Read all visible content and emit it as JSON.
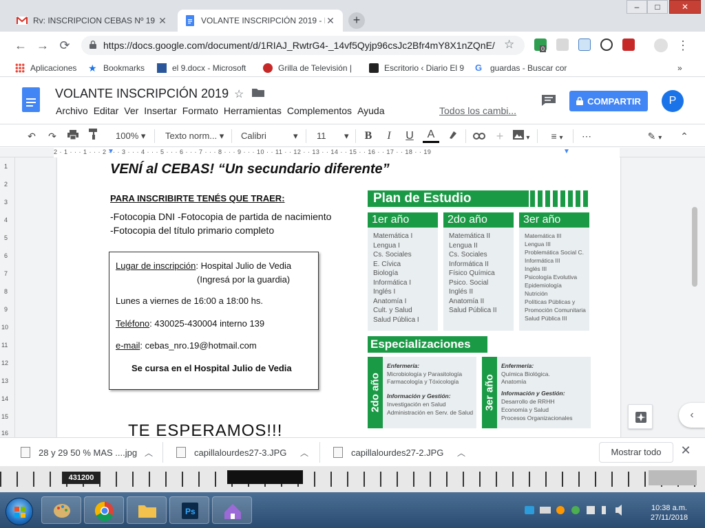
{
  "browser": {
    "tabs": [
      {
        "title": "Rv: INSCRIPCION CEBAS Nº 19 -",
        "icon": "gmail-icon"
      },
      {
        "title": "VOLANTE INSCRIPCIÓN 2019 - D",
        "icon": "docs-icon"
      }
    ],
    "url": "https://docs.google.com/document/d/1RIAJ_RwtrG4-_14vf5Qyjp96csJc2Bfr4mY8X1nZQnE/...",
    "extension_badge": "0",
    "bookmarks": [
      {
        "label": "Aplicaciones"
      },
      {
        "label": "Bookmarks"
      },
      {
        "label": "el 9.docx - Microsoft"
      },
      {
        "label": "Grilla de Televisión |"
      },
      {
        "label": "Escritorio ‹ Diario El 9"
      },
      {
        "label": "guardas - Buscar cor"
      }
    ],
    "bookmarks_more": "»"
  },
  "docs": {
    "title": "VOLANTE INSCRIPCIÓN 2019",
    "menu": [
      "Archivo",
      "Editar",
      "Ver",
      "Insertar",
      "Formato",
      "Herramientas",
      "Complementos",
      "Ayuda"
    ],
    "last_edit": "Todos los cambi...",
    "share_label": "COMPARTIR",
    "avatar_letter": "P",
    "toolbar": {
      "zoom": "100%",
      "style": "Texto norm...",
      "font": "Calibri",
      "size": "11"
    },
    "ruler_ticks": "2 · 1 · · · 1 · · · 2 · · · 3 · · · 4 · · · 5 · · · 6 · · · 7 · · · 8 · · · 9 · · · 10 · · 11 · · 12 · · 13 · · 14 · · 15 · · 16 · · 17 · · 18 · · 19",
    "vruler": [
      "1",
      "2",
      "3",
      "4",
      "5",
      "6",
      "7",
      "8",
      "9",
      "10",
      "11",
      "12",
      "13",
      "14",
      "15",
      "16"
    ]
  },
  "document": {
    "headline": "VENÍ al CEBAS! “Un secundario diferente”",
    "requirements_title": "PARA INSCRIBIRTE TENÉS QUE TRAER",
    "requirements_colon": ":",
    "requirements": [
      "-Fotocopia DNI   -Fotocopia de partida de nacimiento",
      "-Fotocopia del título primario completo"
    ],
    "info": {
      "place_label": "Lugar de inscripción",
      "place_value": ": Hospital Julio de Vedia",
      "place_note": "(Ingresá por la guardia)",
      "schedule": "Lunes a viernes de 16:00 a 18:00 hs.",
      "phone_label": "Teléfono",
      "phone_value": ": 430025-430004 interno 139",
      "email_label": "e-mail",
      "email_value": ": cebas_nro.19@hotmail.com",
      "footer": "Se cursa en el Hospital Julio de Vedia"
    },
    "closing": "TE   ESPERAMOS!!!"
  },
  "study_plan": {
    "title": "Plan de Estudio",
    "years": [
      {
        "label": "1er año",
        "subjects": [
          "Matemática I",
          "Lengua I",
          "Cs. Sociales",
          "E. Cívica",
          "Biología",
          "Informática I",
          "Inglés I",
          "Anatomía I",
          "Cult. y Salud",
          "Salud Pública I"
        ]
      },
      {
        "label": "2do año",
        "subjects": [
          "Matemática II",
          "Lengua II",
          "Cs. Sociales",
          "Informática II",
          "Físico Química",
          "Psico. Social",
          "Inglés II",
          "Anatomía II",
          "Salud Pública II"
        ]
      },
      {
        "label": "3er año",
        "subjects": [
          "Matemática III",
          "Lengua III",
          "Problemática Social C.",
          "Informática III",
          "Inglés III",
          "Psicología Evolutiva",
          "Epidemiología",
          "Nutrición",
          "Políticas Públicas y",
          "Promoción Comunitaria",
          "Salud Pública III"
        ]
      }
    ],
    "spec_title": "Especializaciones",
    "specs": [
      {
        "year": "2do año",
        "groups": [
          {
            "name": "Enfermería:",
            "items": [
              "Microbiología y Parasitología",
              "Farmacología y Tóxicología"
            ]
          },
          {
            "name": "Información y Gestión:",
            "items": [
              "Investigación en Salud",
              "Administración en Serv. de Salud"
            ]
          }
        ]
      },
      {
        "year": "3er año",
        "groups": [
          {
            "name": "Enfermería:",
            "items": [
              "Química Biológica.",
              "Anatomía"
            ]
          },
          {
            "name": "Información y Gestión:",
            "items": [
              "Desarrollo de  RRHH",
              "Economía y Salud",
              "Procesos Organizacionales"
            ]
          }
        ]
      }
    ]
  },
  "downloads": {
    "items": [
      "28 y 29 50 % MAS ....jpg",
      "capillalourdes27-3.JPG",
      "capillalourdes27-2.JPG"
    ],
    "show_all": "Mostrar todo"
  },
  "desktop": {
    "number_label": "431200"
  },
  "taskbar": {
    "time": "10:38 a.m.",
    "date": "27/11/2018"
  },
  "colors": {
    "plan_green": "#1b9a46",
    "share_blue": "#4285f4"
  }
}
